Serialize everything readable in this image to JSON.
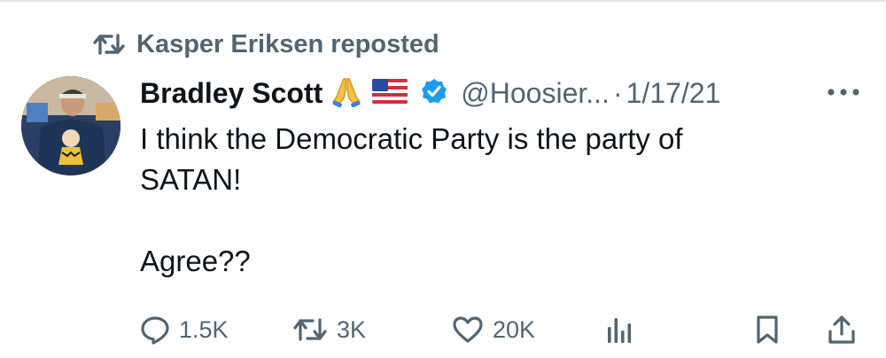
{
  "repost": {
    "icon": "repost-icon",
    "text": "Kasper Eriksen reposted"
  },
  "tweet": {
    "author_name": "Bradley Scott",
    "emoji": [
      "folded-hands-emoji",
      "us-flag-emoji"
    ],
    "verified_icon": "verified-badge-icon",
    "handle": "@Hoosier...",
    "separator": "·",
    "date": "1/17/21",
    "more_icon": "more-options-icon",
    "text_line1": "I think the Democratic Party is the party of",
    "text_line2": "SATAN!",
    "text_line3": "Agree??"
  },
  "actions": {
    "reply": {
      "icon": "reply-icon",
      "count": "1.5K"
    },
    "repost": {
      "icon": "repost-icon",
      "count": "3K"
    },
    "like": {
      "icon": "heart-icon",
      "count": "20K"
    },
    "views": {
      "icon": "analytics-icon"
    },
    "bookmark": {
      "icon": "bookmark-icon"
    },
    "share": {
      "icon": "share-icon"
    }
  },
  "colors": {
    "text_primary": "#0f1419",
    "text_secondary": "#536471",
    "verified_blue": "#1d9bf0",
    "divider": "#e6e9ec"
  }
}
